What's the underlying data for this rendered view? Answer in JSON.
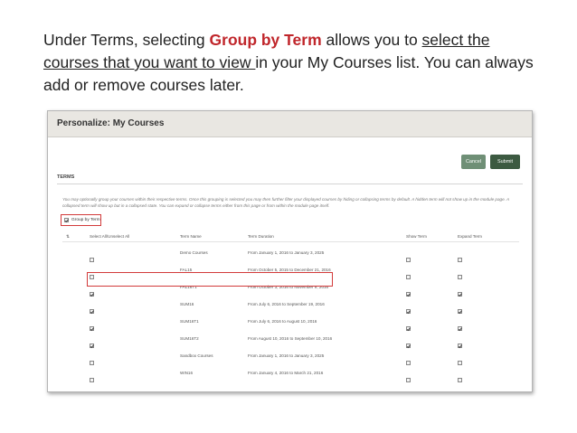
{
  "caption": {
    "pre": "Under Terms, selecting ",
    "highlight": "Group by Term",
    "mid": " allows you to ",
    "underlined": "select the courses that you want to view ",
    "post": "in your My Courses list. You can always add or remove courses later."
  },
  "panel": {
    "title": "Personalize: My Courses",
    "cancel_label": "Cancel",
    "submit_label": "Submit",
    "section_label": "TERMS",
    "description": "You may optionally group your courses within their respective terms. Once this grouping is selected you may then further filter your displayed courses by hiding or collapsing terms by default. A hidden term will not show up in the module page. A collapsed term will show up but in a collapsed state. You can expand or collapse terms either from this page or from within the module page itself.",
    "group_by_term_label": "Group by Term",
    "group_by_term_checked": true,
    "columns": {
      "sort": "⇅",
      "select_all": "Select All/Unselect All",
      "term_name": "Term Name",
      "term_duration": "Term Duration",
      "show_term": "Show Term",
      "expand_term": "Expand Term"
    },
    "rows": [
      {
        "selected": false,
        "name": "Demo Courses",
        "duration": "From January 1, 2016 to January 3, 2025",
        "show": false,
        "expand": false
      },
      {
        "selected": false,
        "name": "FAL15",
        "duration": "From October 5, 2015 to December 21, 2016",
        "show": false,
        "expand": false
      },
      {
        "selected": true,
        "name": "FAL16T1",
        "duration": "From October 3, 2016 to November 9, 2016",
        "show": true,
        "expand": true
      },
      {
        "selected": true,
        "name": "SUM16",
        "duration": "From July 6, 2016 to September 19, 2016",
        "show": true,
        "expand": true
      },
      {
        "selected": true,
        "name": "SUM16T1",
        "duration": "From July 6, 2016 to August 10, 2016",
        "show": true,
        "expand": true
      },
      {
        "selected": true,
        "name": "SUM16T2",
        "duration": "From August 10, 2016 to September 10, 2016",
        "show": true,
        "expand": true
      },
      {
        "selected": false,
        "name": "Sandbox Courses",
        "duration": "From January 1, 2016 to January 3, 2025",
        "show": false,
        "expand": false
      },
      {
        "selected": false,
        "name": "WIN16",
        "duration": "From January 4, 2016 to March 21, 2016",
        "show": false,
        "expand": false
      }
    ]
  }
}
